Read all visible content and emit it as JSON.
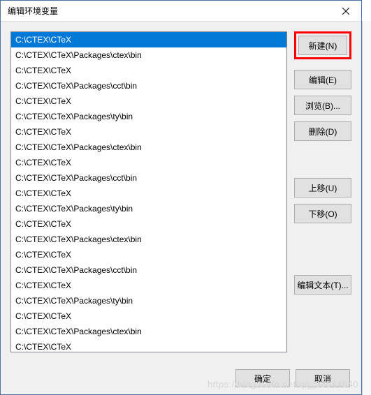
{
  "window": {
    "title": "编辑环境变量"
  },
  "list": {
    "items": [
      "C:\\CTEX\\CTeX",
      "C:\\CTEX\\CTeX\\Packages\\ctex\\bin",
      "C:\\CTEX\\CTeX",
      "C:\\CTEX\\CTeX\\Packages\\cct\\bin",
      "C:\\CTEX\\CTeX",
      "C:\\CTEX\\CTeX\\Packages\\ty\\bin",
      "C:\\CTEX\\CTeX",
      "C:\\CTEX\\CTeX\\Packages\\ctex\\bin",
      "C:\\CTEX\\CTeX",
      "C:\\CTEX\\CTeX\\Packages\\cct\\bin",
      "C:\\CTEX\\CTeX",
      "C:\\CTEX\\CTeX\\Packages\\ty\\bin",
      "C:\\CTEX\\CTeX",
      "C:\\CTEX\\CTeX\\Packages\\ctex\\bin",
      "C:\\CTEX\\CTeX",
      "C:\\CTEX\\CTeX\\Packages\\cct\\bin",
      "C:\\CTEX\\CTeX",
      "C:\\CTEX\\CTeX\\Packages\\ty\\bin",
      "C:\\CTEX\\CTeX",
      "C:\\CTEX\\CTeX\\Packages\\ctex\\bin",
      "C:\\CTEX\\CTeX"
    ],
    "selected_index": 0
  },
  "buttons": {
    "new": "新建(N)",
    "edit": "编辑(E)",
    "browse": "浏览(B)...",
    "delete": "删除(D)",
    "move_up": "上移(U)",
    "move_down": "下移(O)",
    "edit_text": "编辑文本(T)...",
    "ok": "确定",
    "cancel": "取消"
  },
  "watermark": "https://blog.csdn.net/qq_38044840"
}
